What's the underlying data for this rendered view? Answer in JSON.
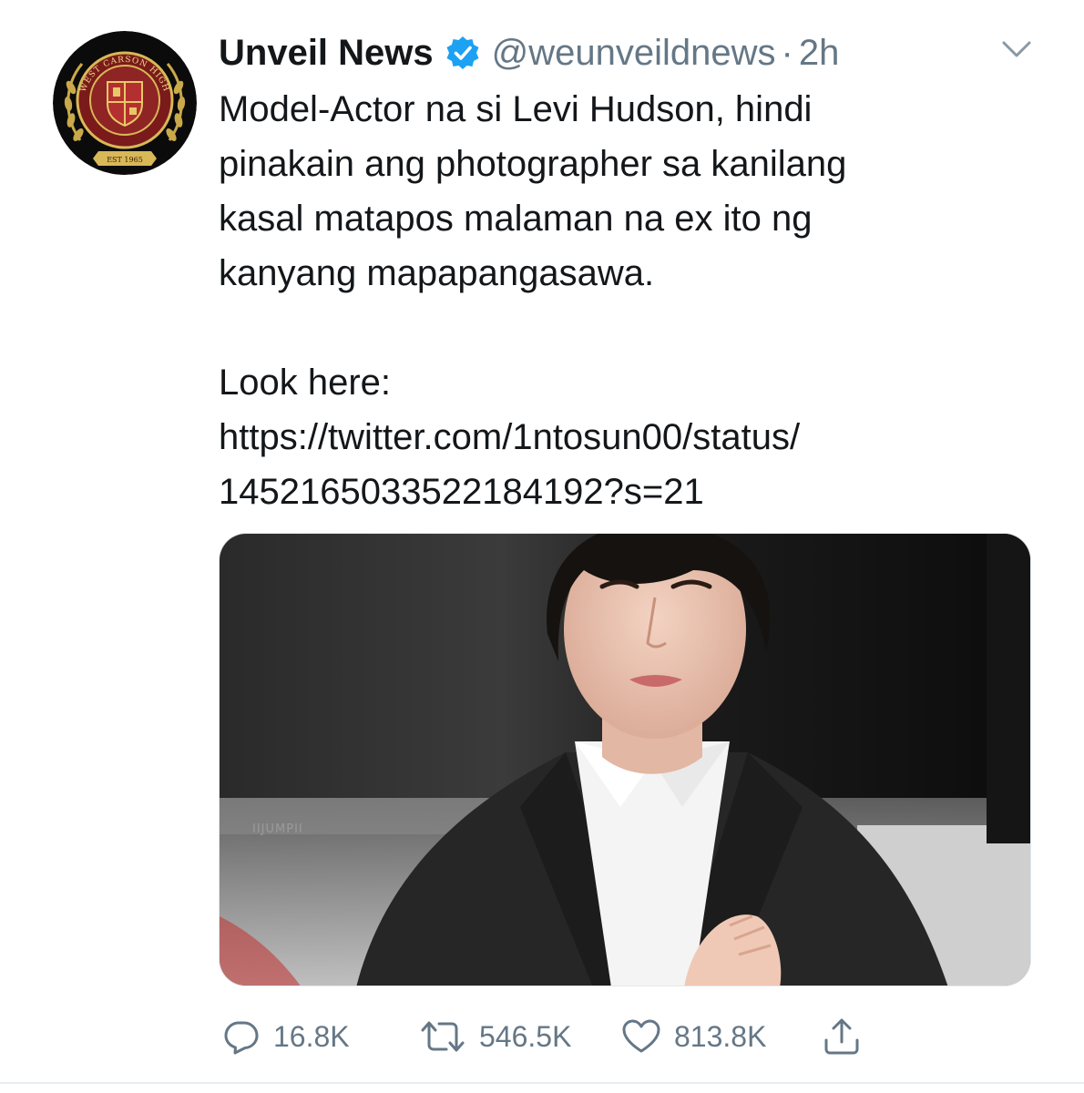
{
  "tweet": {
    "author": {
      "display_name": "Unveil News",
      "handle": "@weunveildnews",
      "verified": true,
      "avatar_icon": "school-crest-icon",
      "avatar_text": {
        "arc": "WEST CARSON HIGH",
        "est": "EST 1965"
      }
    },
    "separator": "·",
    "time": "2h",
    "text_lines": [
      "Model-Actor na si Levi Hudson, hindi",
      "pinakain ang photographer sa kanilang",
      "kasal matapos malaman na ex ito ng",
      "kanyang mapapangasawa."
    ],
    "link_intro": "Look here:",
    "link_lines": [
      "https://twitter.com/1ntosun00/status/",
      "1452165033522184192?s=21"
    ],
    "media": {
      "watermark": "IIJUMPII"
    },
    "actions": {
      "reply_count": "16.8K",
      "retweet_count": "546.5K",
      "like_count": "813.8K"
    }
  },
  "colors": {
    "text_primary": "#14171a",
    "text_secondary": "#657786",
    "verified_blue": "#1da1f2"
  }
}
